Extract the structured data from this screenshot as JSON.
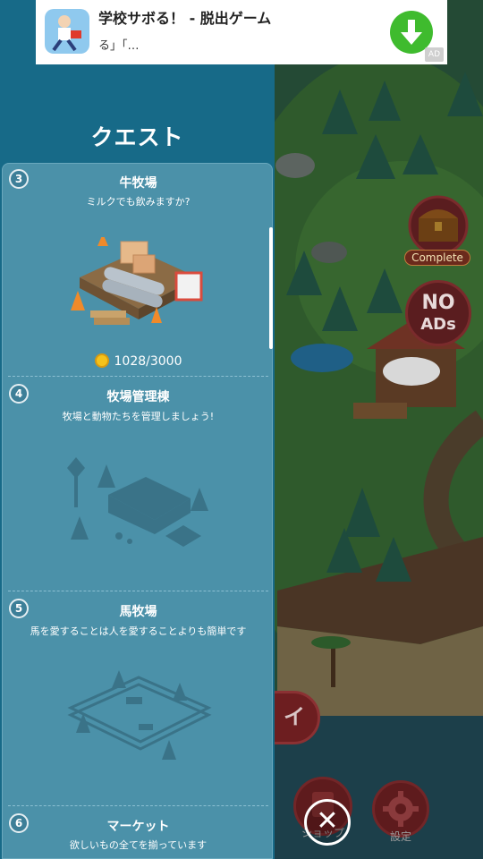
{
  "ad": {
    "title": "学校サボる！ - 脱出ゲーム",
    "description": "る」「…",
    "badge": "AD",
    "download_icon": "download-arrow-icon"
  },
  "panel": {
    "title": "クエスト"
  },
  "quests": [
    {
      "number": "3",
      "name": "牛牧場",
      "description": "ミルクでも飲みますか?",
      "progress": "1028/3000",
      "current": 1028,
      "total": 3000,
      "art": "construction-site-icon"
    },
    {
      "number": "4",
      "name": "牧場管理棟",
      "description": "牧場と動物たちを管理しましょう!",
      "art": "farm-house-silhouette-icon"
    },
    {
      "number": "5",
      "name": "馬牧場",
      "description": "馬を愛することは人を愛することよりも簡単です",
      "art": "horse-pen-silhouette-icon"
    },
    {
      "number": "6",
      "name": "マーケット",
      "description": "欲しいもの全てを揃っています"
    }
  ],
  "buttons": {
    "complete_label": "Complete",
    "noads_line1": "NO",
    "noads_line2": "ADs",
    "play_label": "イ",
    "shop_label": "ショップ",
    "settings_label": "設定",
    "close_label": "✕"
  },
  "colors": {
    "panel_bg": "#176a88",
    "list_bg": "#4b91a9",
    "download_green": "#3fbb2e"
  }
}
